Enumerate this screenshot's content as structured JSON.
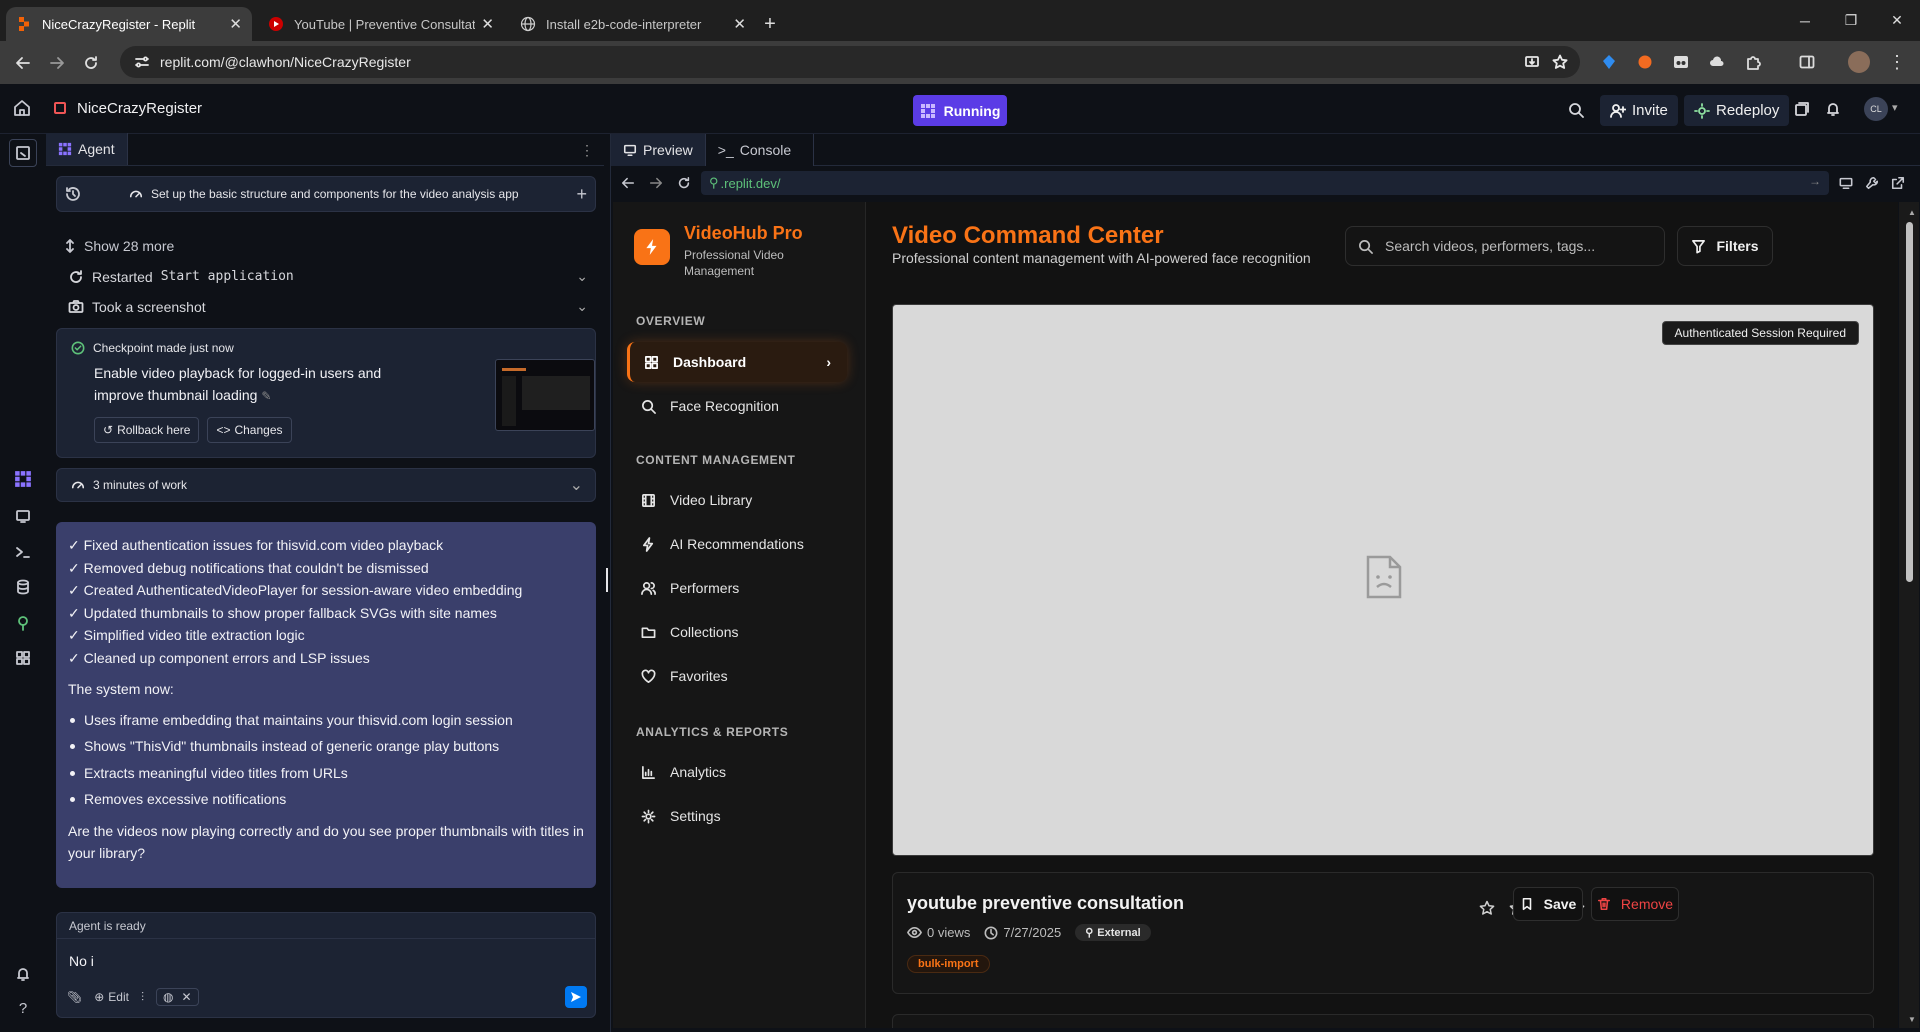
{
  "browser": {
    "tabs": [
      {
        "title": "NiceCrazyRegister - Replit",
        "active": true
      },
      {
        "title": "YouTube | Preventive Consultati",
        "active": false
      },
      {
        "title": "Install e2b-code-interpreter",
        "active": false
      }
    ],
    "url": "replit.com/@clawhon/NiceCrazyRegister"
  },
  "replit": {
    "project_name": "NiceCrazyRegister",
    "run_status": "Running",
    "invite_label": "Invite",
    "redeploy_label": "Redeploy",
    "avatar_initials": "CL"
  },
  "agent": {
    "tab_label": "Agent",
    "task_title": "Set up the basic structure and components for the video analysis app",
    "show_more": "Show 28 more",
    "restarted_prefix": "Restarted",
    "restarted_code": "Start application",
    "screenshot_label": "Took a screenshot",
    "checkpoint": {
      "label": "Checkpoint made just now",
      "description": "Enable video playback for logged-in users and improve thumbnail loading",
      "rollback_label": "Rollback here",
      "changes_label": "Changes"
    },
    "work_time": "3 minutes of work",
    "message": {
      "checks": [
        "✓ Fixed authentication issues for thisvid.com video playback",
        "✓ Removed debug notifications that couldn't be dismissed",
        "✓ Created AuthenticatedVideoPlayer for session-aware video embedding",
        "✓ Updated thumbnails to show proper fallback SVGs with site names",
        "✓ Simplified video title extraction logic",
        "✓ Cleaned up component errors and LSP issues"
      ],
      "intro": "The system now:",
      "bullets": [
        "Uses iframe embedding that maintains your thisvid.com login session",
        "Shows \"ThisVid\" thumbnails instead of generic orange play buttons",
        "Extracts meaningful video titles from URLs",
        "Removes excessive notifications"
      ],
      "question": "Are the videos now playing correctly and do you see proper thumbnails with titles in your library?"
    },
    "composer": {
      "status": "Agent is ready",
      "input_value": "No i",
      "edit_label": "Edit"
    }
  },
  "preview": {
    "tabs": [
      "Preview",
      "Console"
    ],
    "url": ".replit.dev/"
  },
  "app": {
    "brand_name": "VideoHub Pro",
    "brand_subtitle": "Professional Video Management",
    "sections": [
      {
        "title": "OVERVIEW",
        "items": [
          "Dashboard",
          "Face Recognition"
        ]
      },
      {
        "title": "CONTENT MANAGEMENT",
        "items": [
          "Video Library",
          "AI Recommendations",
          "Performers",
          "Collections",
          "Favorites"
        ]
      },
      {
        "title": "ANALYTICS & REPORTS",
        "items": [
          "Analytics",
          "Settings"
        ]
      }
    ],
    "active_item": "Dashboard",
    "page_title": "Video Command Center",
    "page_subtitle": "Professional content management with AI-powered face recognition",
    "search_placeholder": "Search videos, performers, tags...",
    "filters_label": "Filters",
    "player_badge": "Authenticated Session Required",
    "video": {
      "title": "youtube preventive consultation",
      "views": "0 views",
      "date": "7/27/2025",
      "source_badge": "External",
      "tag": "bulk-import",
      "rating": 0,
      "save_label": "Save",
      "remove_label": "Remove"
    }
  },
  "colors": {
    "accent_orange": "#f97316",
    "replit_purple": "#5b3ce6",
    "message_bg": "#3a3f6b",
    "remove_red": "#ef4444"
  }
}
